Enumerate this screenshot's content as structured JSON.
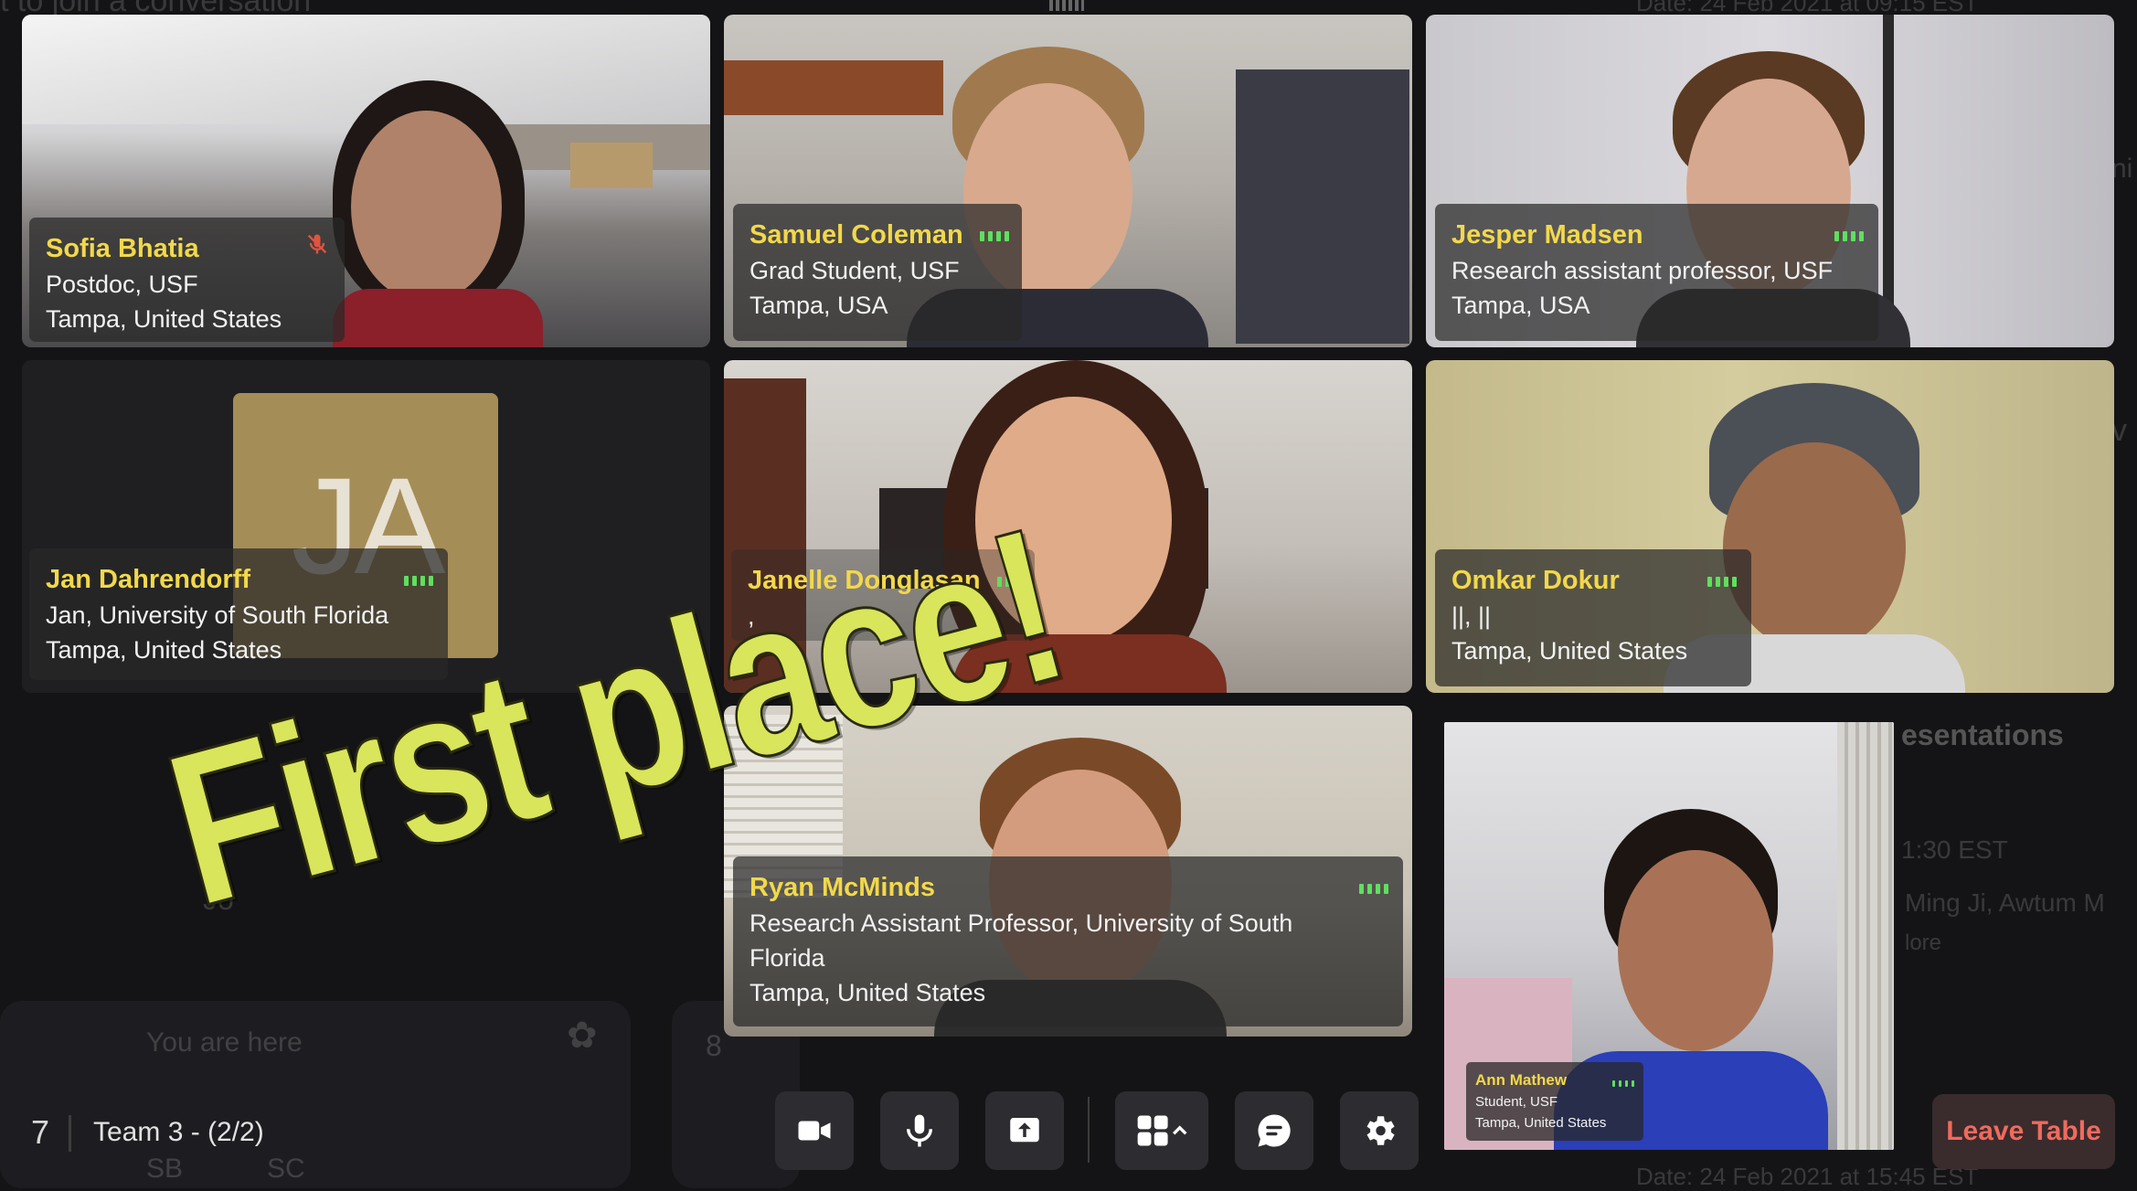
{
  "background": {
    "top_text": "t to join a conversation",
    "date_top": "Date: 24 Feb 2021 at 09:15 EST",
    "presentations": "esentations",
    "time": "1:30 EST",
    "names": "Ming Ji, Awtum M",
    "more": "lore",
    "you_are_here": "You are here",
    "join": "Jo",
    "table_8": "8",
    "date_bottom": "Date: 24 Feb 2021 at 15:45 EST",
    "badge_sb": "SB",
    "badge_sc": "SC",
    "right_edge_1": "ni",
    "right_edge_2": "v"
  },
  "participants": [
    {
      "name": "Sofia Bhatia",
      "line1": "Postdoc, USF",
      "line2": "Tampa, United States",
      "muted": true
    },
    {
      "name": "Samuel Coleman",
      "line1": "Grad Student, USF",
      "line2": "Tampa, USA",
      "muted": false
    },
    {
      "name": "Jesper Madsen",
      "line1": "Research assistant professor, USF",
      "line2": "Tampa, USA",
      "muted": false
    },
    {
      "name": "Jan Dahrendorff",
      "initials": "JA",
      "line1": "Jan, University of South Florida",
      "line2": "Tampa, United States",
      "muted": false
    },
    {
      "name": "Janelle Donglasan",
      "line1": ",",
      "muted": false
    },
    {
      "name": "Omkar Dokur",
      "line1": "||, ||",
      "line2": "Tampa, United States",
      "muted": false
    },
    {
      "name": "Ryan McMinds",
      "line1": "Research Assistant Professor, University of South",
      "line1b": "Florida",
      "line2": "Tampa, United States",
      "muted": false
    },
    {
      "name": "Ann Mathew",
      "line1": "Student, USF",
      "line2": "Tampa, United States",
      "muted": false
    }
  ],
  "overlay_text": "First place!",
  "bottom_bar": {
    "room_number": "7",
    "room_name": "Team 3 - (2/2)",
    "controls": [
      "camera-icon",
      "microphone-icon",
      "share-screen-icon",
      "layout-grid-icon",
      "chat-icon",
      "settings-icon"
    ],
    "leave_label": "Leave Table"
  },
  "colors": {
    "name": "#f2d84b",
    "signal": "#5ee05e",
    "leave": "#f06a5e",
    "overlay": "#d9e55a"
  }
}
